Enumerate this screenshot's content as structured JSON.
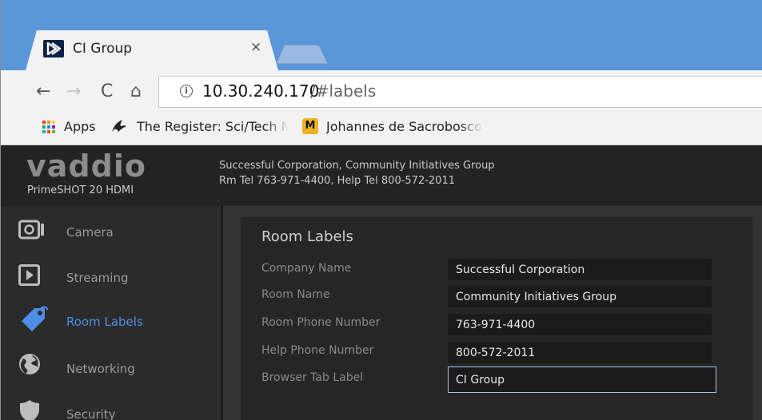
{
  "browser": {
    "tab": {
      "title": "CI Group",
      "close_glyph": "×"
    },
    "omnibox": {
      "host": "10.30.240.170",
      "path": "/#labels"
    },
    "nav_glyphs": {
      "back": "←",
      "forward": "→",
      "reload": "C",
      "home": "⌂",
      "info": "i"
    },
    "bookmarks": [
      {
        "label": "Apps",
        "icon": "apps-grid-icon"
      },
      {
        "label": "The Register: Sci/Tech News",
        "icon": "register-vulture-icon"
      },
      {
        "label": "Johannes de Sacrobosco",
        "icon": "mizzou-m-icon"
      }
    ],
    "mizzou_glyph": "M",
    "accent": "#5b96d8"
  },
  "app": {
    "brand": "vaddio",
    "model": "PrimeSHOT 20 HDMI",
    "header_line1": "Successful Corporation, Community Initiatives Group",
    "header_line2": "Rm Tel 763-971-4400, Help Tel 800-572-2011",
    "accent": "#4d8fe6"
  },
  "sidebar": {
    "items": [
      {
        "label": "Camera",
        "icon": "camera-icon",
        "active": false
      },
      {
        "label": "Streaming",
        "icon": "play-icon",
        "active": false
      },
      {
        "label": "Room Labels",
        "icon": "tag-icon",
        "active": true
      },
      {
        "label": "Networking",
        "icon": "globe-icon",
        "active": false
      },
      {
        "label": "Security",
        "icon": "shield-icon",
        "active": false
      }
    ]
  },
  "room_labels": {
    "title": "Room Labels",
    "fields": [
      {
        "label": "Company Name",
        "value": "Successful Corporation"
      },
      {
        "label": "Room Name",
        "value": "Community Initiatives Group"
      },
      {
        "label": "Room Phone Number",
        "value": "763-971-4400"
      },
      {
        "label": "Help Phone Number",
        "value": "800-572-2011"
      },
      {
        "label": "Browser Tab Label",
        "value": "CI Group"
      }
    ]
  }
}
